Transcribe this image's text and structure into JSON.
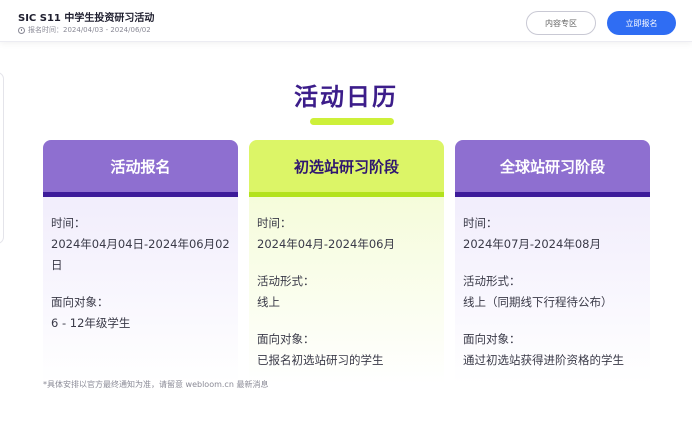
{
  "header": {
    "title": "SIC S11 中学生投资研习活动",
    "date_text": "报名时间：2024/04/03 - 2024/06/02",
    "btn_content": "内容专区",
    "btn_signup": "立即报名"
  },
  "section": {
    "title": "活动日历"
  },
  "cards": [
    {
      "head": "活动报名",
      "l1": "时间：",
      "l2": "2024年04月04日-2024年06月02日",
      "l3": "面向对象：",
      "l4": "6 - 12年级学生"
    },
    {
      "head": "初选站研习阶段",
      "l1": "时间：",
      "l2": "2024年04月-2024年06月",
      "l3": "活动形式：",
      "l4": "线上",
      "l5": "面向对象：",
      "l6": "已报名初选站研习的学生"
    },
    {
      "head": "全球站研习阶段",
      "l1": "时间：",
      "l2": "2024年07月-2024年08月",
      "l3": "活动形式：",
      "l4": "线上（同期线下行程待公布）",
      "l5": "面向对象：",
      "l6": "通过初选站获得进阶资格的学生"
    }
  ],
  "footnote": "*具体安排以官方最终通知为准，请留意 webloom.cn 最新消息",
  "colors": {
    "accent_purple": "#8e6fd0",
    "deep_purple": "#3d1b9a",
    "lime": "#dcf567",
    "primary_blue": "#2f6df3"
  }
}
